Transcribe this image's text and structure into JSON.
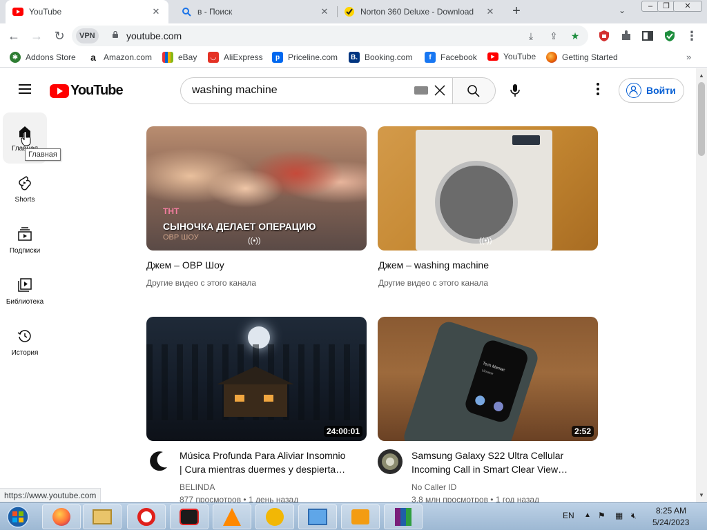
{
  "browser": {
    "tabs": [
      {
        "title": "YouTube",
        "icon": "youtube-favicon",
        "active": true
      },
      {
        "title": "в - Поиск",
        "icon": "search-favicon",
        "active": false
      },
      {
        "title": "Norton 360 Deluxe - Download",
        "icon": "norton-favicon",
        "active": false
      }
    ],
    "vpn_label": "VPN",
    "url": "youtube.com",
    "bookmarks": [
      {
        "label": "Addons Store",
        "icon": "addons-store-icon",
        "color": "#2e7d32"
      },
      {
        "label": "Amazon.com",
        "icon": "amazon-icon",
        "color": "#222222"
      },
      {
        "label": "eBay",
        "icon": "ebay-icon",
        "color": "#f5af02"
      },
      {
        "label": "AliExpress",
        "icon": "aliexpress-icon",
        "color": "#e43225"
      },
      {
        "label": "Priceline.com",
        "icon": "priceline-icon",
        "color": "#0068ef"
      },
      {
        "label": "Booking.com",
        "icon": "booking-icon",
        "color": "#003580"
      },
      {
        "label": "Facebook",
        "icon": "facebook-icon",
        "color": "#1877f2"
      },
      {
        "label": "YouTube",
        "icon": "youtube-icon",
        "color": "#ff0000"
      },
      {
        "label": "Getting Started",
        "icon": "firefox-icon",
        "color": "#e66000"
      }
    ],
    "status_url": "https://www.youtube.com"
  },
  "youtube": {
    "logo_text": "YouTube",
    "search_query": "washing machine",
    "signin_label": "Войти",
    "nav": [
      {
        "label": "Главная",
        "icon": "home-icon"
      },
      {
        "label": "Shorts",
        "icon": "shorts-icon"
      },
      {
        "label": "Подписки",
        "icon": "subscriptions-icon"
      },
      {
        "label": "Библиотека",
        "icon": "library-icon"
      },
      {
        "label": "История",
        "icon": "history-icon"
      }
    ],
    "tooltip": "Главная",
    "videos": [
      {
        "title": "Джем – ОВР Шоу",
        "meta": "Другие видео с этого канала",
        "badge": "live",
        "overlay_brand": "ТНТ",
        "overlay_text": "СЫНОЧКА ДЕЛАЕТ ОПЕРАЦИЮ",
        "overlay_sub": "ОВР ШОУ"
      },
      {
        "title": "Джем – washing machine",
        "meta": "Другие видео с этого канала",
        "badge": "live"
      },
      {
        "title_line1": "Música Profunda Para Aliviar Insomnio",
        "title_line2": "| Cura mientras duermes y despierta…",
        "channel": "BELINDA",
        "stats": "877 просмотров • 1 день назад",
        "duration": "24:00:01"
      },
      {
        "title_line1": "Samsung Galaxy S22 Ultra Cellular",
        "title_line2": "Incoming Call in Smart Clear View…",
        "channel": "No Caller ID",
        "stats": "3,8 млн просмотров • 1 год назад",
        "duration": "2:52",
        "phone_caller": "Tech Maniac",
        "phone_sub": "Ukraine"
      }
    ]
  },
  "taskbar": {
    "apps": [
      "firefox-icon",
      "file-explorer-icon",
      "opera-icon",
      "screen-recorder-icon",
      "vlc-icon",
      "avast-icon",
      "control-panel-icon",
      "video-player-icon",
      "winrar-icon"
    ],
    "lang": "EN",
    "time": "8:25 AM",
    "date": "5/24/2023"
  },
  "colors": {
    "brand_red": "#ff0000",
    "link_blue": "#065fd4",
    "tab_strip": "#dee1e6"
  }
}
